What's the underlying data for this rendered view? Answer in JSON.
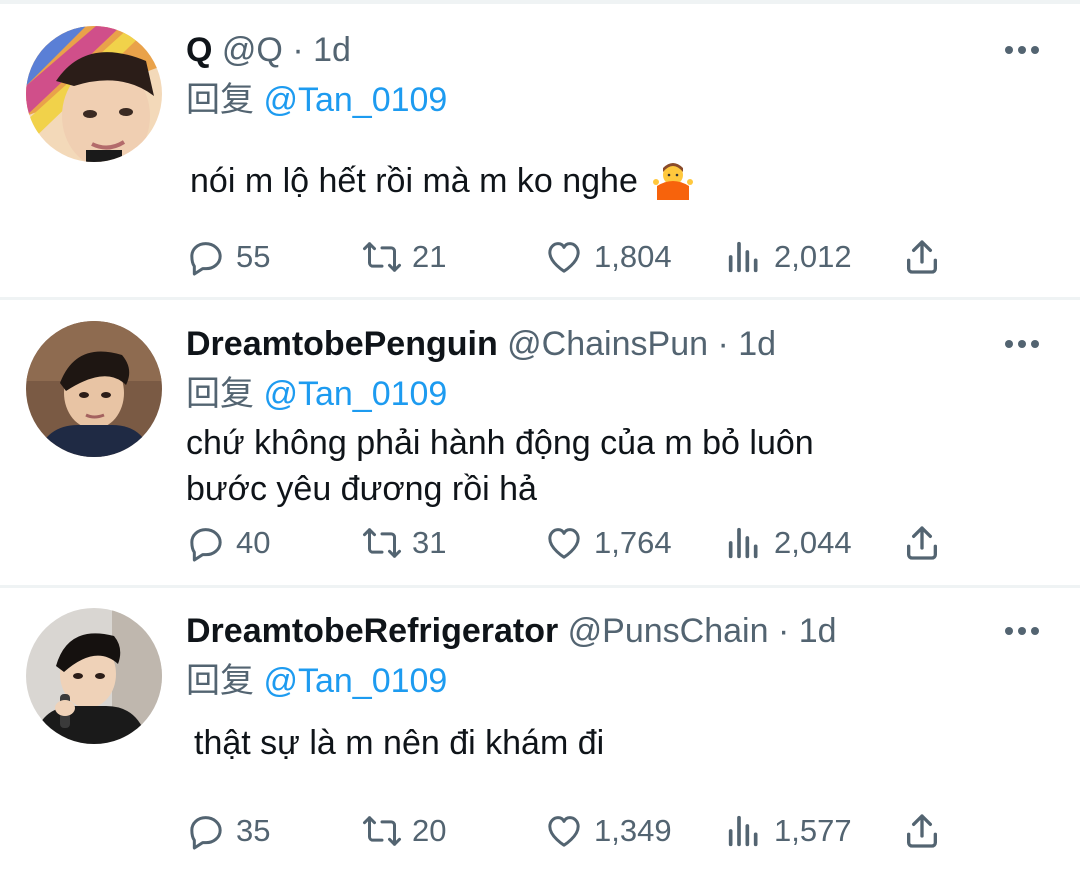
{
  "colors": {
    "text": "#0f1419",
    "secondary": "#536471",
    "link": "#1d9bf0",
    "divider": "#eff3f4"
  },
  "tweets": [
    {
      "name": "Q",
      "handle": "@Q",
      "dot": "·",
      "time": "1d",
      "reply_prefix": "回复",
      "reply_to": "@Tan_0109",
      "text_lines": [
        "nói m lộ hết rồi mà m ko nghe"
      ],
      "emoji": "person-shrugging",
      "replies": "55",
      "retweets": "21",
      "likes": "1,804",
      "views": "2,012"
    },
    {
      "name": "DreamtobePenguin",
      "handle": "@ChainsPun",
      "dot": "·",
      "time": "1d",
      "reply_prefix": "回复",
      "reply_to": "@Tan_0109",
      "text_lines": [
        "chứ không phải hành động của m bỏ luôn",
        "bước yêu đương rồi hả"
      ],
      "replies": "40",
      "retweets": "31",
      "likes": "1,764",
      "views": "2,044"
    },
    {
      "name": "DreamtobeRefrigerator",
      "handle": "@PunsChain",
      "dot": "·",
      "time": "1d",
      "reply_prefix": "回复",
      "reply_to": "@Tan_0109",
      "text_lines": [
        "thật sự là m nên đi khám đi"
      ],
      "replies": "35",
      "retweets": "20",
      "likes": "1,349",
      "views": "1,577"
    }
  ],
  "icons": {
    "more": "more-dots-icon",
    "reply": "reply-icon",
    "retweet": "retweet-icon",
    "like": "heart-icon",
    "views": "views-icon",
    "share": "share-icon"
  }
}
